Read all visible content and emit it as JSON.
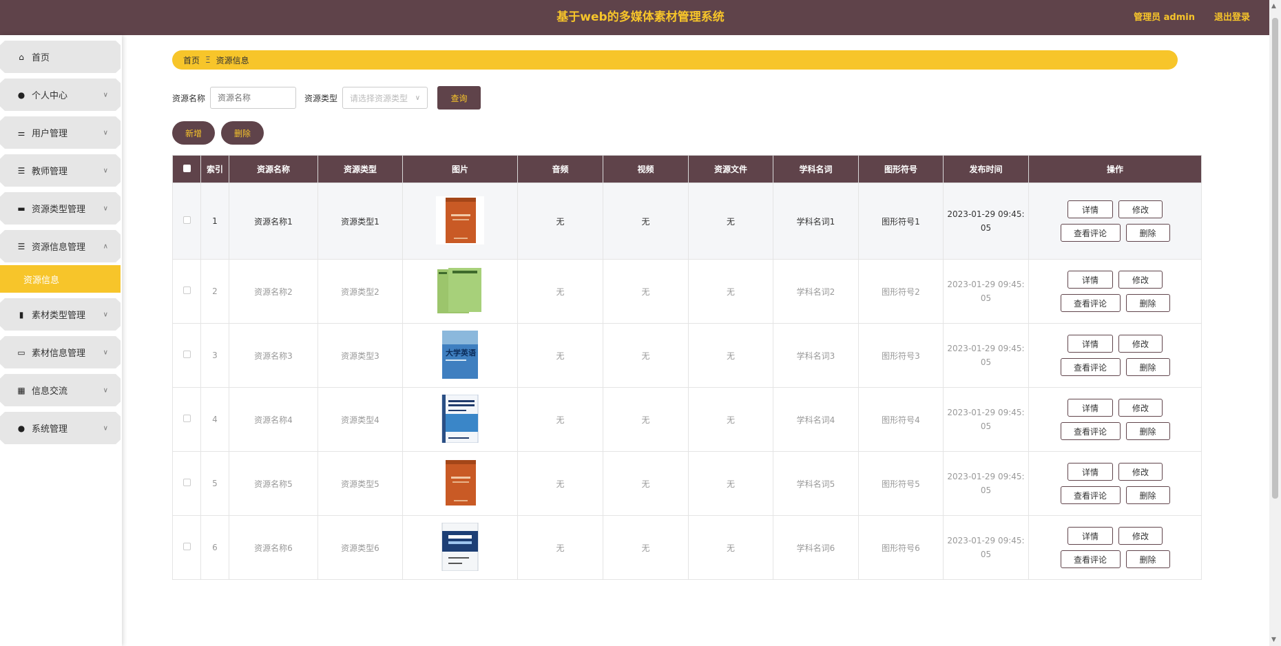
{
  "header": {
    "title": "基于web的多媒体素材管理系统",
    "user": "管理员 admin",
    "logout": "退出登录"
  },
  "sidebar": {
    "items": [
      {
        "label": "首页",
        "icon": "home-icon",
        "arrow": false
      },
      {
        "label": "个人中心",
        "icon": "user-icon",
        "arrow": true
      },
      {
        "label": "用户管理",
        "icon": "sliders-icon",
        "arrow": true
      },
      {
        "label": "教师管理",
        "icon": "list-icon",
        "arrow": true
      },
      {
        "label": "资源类型管理",
        "icon": "billboard-icon",
        "arrow": true
      },
      {
        "label": "资源信息管理",
        "icon": "list-icon",
        "arrow": true,
        "expanded": true
      },
      {
        "label": "素材类型管理",
        "icon": "bar-chart-icon",
        "arrow": true
      },
      {
        "label": "素材信息管理",
        "icon": "chat-icon",
        "arrow": true
      },
      {
        "label": "信息交流",
        "icon": "grid-icon",
        "arrow": true
      },
      {
        "label": "系统管理",
        "icon": "user-icon",
        "arrow": true
      }
    ],
    "submenu_active": "资源信息"
  },
  "breadcrumb": {
    "home": "首页",
    "sep": "Ξ",
    "current": "资源信息"
  },
  "search": {
    "name_label": "资源名称",
    "name_placeholder": "资源名称",
    "type_label": "资源类型",
    "type_placeholder": "请选择资源类型",
    "query_button": "查询"
  },
  "actions": {
    "add": "新增",
    "delete": "删除"
  },
  "table": {
    "headers": [
      "索引",
      "资源名称",
      "资源类型",
      "图片",
      "音频",
      "视频",
      "资源文件",
      "学科名词",
      "图形符号",
      "发布时间",
      "操作"
    ],
    "rows": [
      {
        "index": "1",
        "name": "资源名称1",
        "type": "资源类型1",
        "audio": "无",
        "video": "无",
        "file": "无",
        "term": "学科名词1",
        "symbol": "图形符号1",
        "date1": "2023-01-29 09:45:",
        "date2": "05",
        "book": "orange"
      },
      {
        "index": "2",
        "name": "资源名称2",
        "type": "资源类型2",
        "audio": "无",
        "video": "无",
        "file": "无",
        "term": "学科名词2",
        "symbol": "图形符号2",
        "date1": "2023-01-29 09:45:",
        "date2": "05",
        "book": "green"
      },
      {
        "index": "3",
        "name": "资源名称3",
        "type": "资源类型3",
        "audio": "无",
        "video": "无",
        "file": "无",
        "term": "学科名词3",
        "symbol": "图形符号3",
        "date1": "2023-01-29 09:45:",
        "date2": "05",
        "book": "blue"
      },
      {
        "index": "4",
        "name": "资源名称4",
        "type": "资源类型4",
        "audio": "无",
        "video": "无",
        "file": "无",
        "term": "学科名词4",
        "symbol": "图形符号4",
        "date1": "2023-01-29 09:45:",
        "date2": "05",
        "book": "white"
      },
      {
        "index": "5",
        "name": "资源名称5",
        "type": "资源类型5",
        "audio": "无",
        "video": "无",
        "file": "无",
        "term": "学科名词5",
        "symbol": "图形符号5",
        "date1": "2023-01-29 09:45:",
        "date2": "05",
        "book": "orange"
      },
      {
        "index": "6",
        "name": "资源名称6",
        "type": "资源类型6",
        "audio": "无",
        "video": "无",
        "file": "无",
        "term": "学科名词6",
        "symbol": "图形符号6",
        "date1": "2023-01-29 09:45:",
        "date2": "05",
        "book": "navy"
      }
    ],
    "row_buttons": {
      "detail": "详情",
      "edit": "修改",
      "comments": "查看评论",
      "delete": "删除"
    }
  },
  "colors": {
    "primary": "#5f434a",
    "accent": "#f7c52a"
  }
}
